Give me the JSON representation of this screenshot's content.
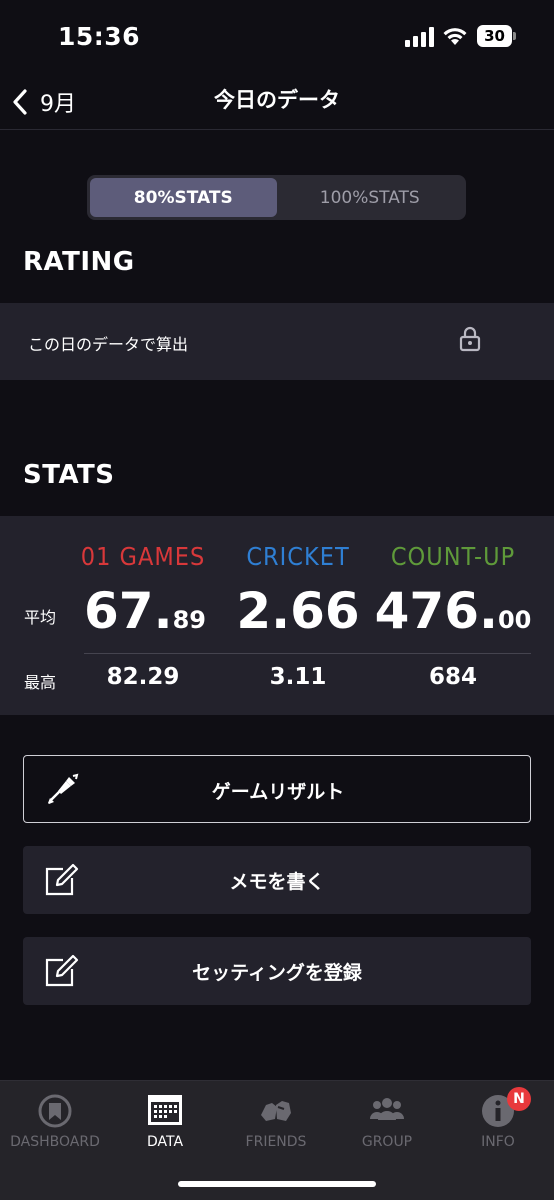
{
  "status": {
    "time": "15:36",
    "battery": "30"
  },
  "nav": {
    "back_label": "9月",
    "title": "今日のデータ"
  },
  "segment": {
    "options": [
      "80%STATS",
      "100%STATS"
    ],
    "selected": "80%STATS"
  },
  "rating": {
    "heading": "RATING",
    "text": "この日のデータで算出",
    "icon": "lock-icon"
  },
  "stats": {
    "heading": "STATS",
    "row_labels": {
      "avg": "平均",
      "max": "最高"
    },
    "columns": [
      {
        "name": "01 GAMES",
        "color": "#d8383a",
        "avg_int": "67.",
        "avg_dec": "89",
        "max": "82.29"
      },
      {
        "name": "CRICKET",
        "color": "#2f7fd3",
        "avg_int": "2.66",
        "avg_dec": "",
        "max": "3.11"
      },
      {
        "name": "COUNT-UP",
        "color": "#5f9a3a",
        "avg_int": "476.",
        "avg_dec": "00",
        "max": "684"
      }
    ]
  },
  "actions": [
    {
      "label": "ゲームリザルト",
      "icon": "dart-icon"
    },
    {
      "label": "メモを書く",
      "icon": "edit-icon"
    },
    {
      "label": "セッティングを登録",
      "icon": "edit-icon"
    }
  ],
  "tabs": [
    {
      "label": "DASHBOARD",
      "icon": "dashboard-icon",
      "active": false
    },
    {
      "label": "DATA",
      "icon": "calendar-icon",
      "active": true
    },
    {
      "label": "FRIENDS",
      "icon": "friends-icon",
      "active": false
    },
    {
      "label": "GROUP",
      "icon": "group-icon",
      "active": false
    },
    {
      "label": "INFO",
      "icon": "info-icon",
      "active": false,
      "badge": "N"
    }
  ]
}
